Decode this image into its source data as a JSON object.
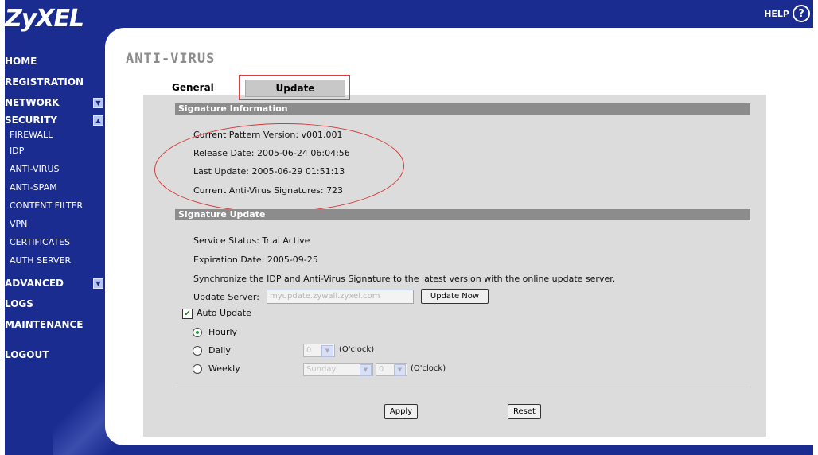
{
  "app": {
    "logo": "ZyXEL",
    "help_label": "HELP",
    "help_icon": "?"
  },
  "nav": {
    "home": "HOME",
    "registration": "REGISTRATION",
    "network": "NETWORK",
    "security": "SECURITY",
    "security_items": [
      "FIREWALL",
      "IDP",
      "ANTI-VIRUS",
      "ANTI-SPAM",
      "CONTENT FILTER",
      "VPN",
      "CERTIFICATES",
      "AUTH SERVER"
    ],
    "advanced": "ADVANCED",
    "logs": "LOGS",
    "maintenance": "MAINTENANCE",
    "logout": "LOGOUT"
  },
  "page": {
    "title": "ANTI-VIRUS"
  },
  "tabs": {
    "general": "General",
    "update": "Update"
  },
  "signature_info": {
    "header": "Signature Information",
    "pattern_version": "Current Pattern Version: v001.001",
    "release_date": "Release Date: 2005-06-24 06:04:56",
    "last_update": "Last Update: 2005-06-29 01:51:13",
    "signatures": "Current Anti-Virus Signatures: 723"
  },
  "signature_update": {
    "header": "Signature Update",
    "service_status": "Service Status: Trial Active",
    "expiration": "Expiration Date: 2005-09-25",
    "sync_text": "Synchronize the IDP and Anti-Virus Signature to the latest version with the online update server.",
    "server_label": "Update Server:",
    "server_value": "myupdate.zywall.zyxel.com",
    "update_now": "Update Now",
    "auto_update": "Auto Update",
    "auto_update_checked": true,
    "hourly": "Hourly",
    "daily": "Daily",
    "weekly": "Weekly",
    "selected": "Hourly",
    "daily_hour": "0",
    "weekly_day": "Sunday",
    "weekly_hour": "0",
    "oclock": "(O'clock)"
  },
  "buttons": {
    "apply": "Apply",
    "reset": "Reset"
  },
  "colors": {
    "nav_bg": "#1a2c8f",
    "panel_bg": "#dcdcdc",
    "section_bar": "#8c8c8c",
    "highlight": "#e23a3a"
  }
}
